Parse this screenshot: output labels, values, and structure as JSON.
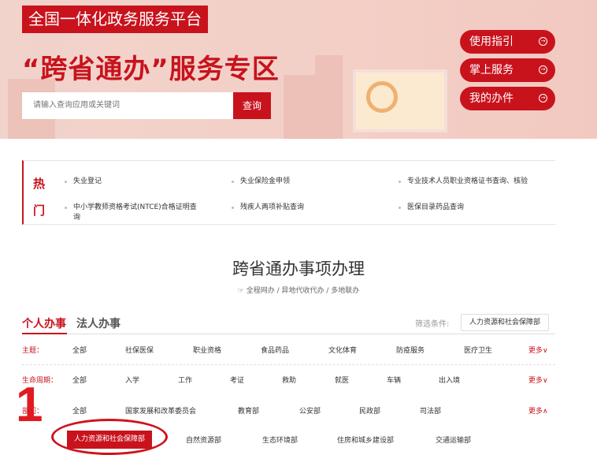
{
  "banner": {
    "platform": "全国一体化政务服务平台",
    "headline": "“跨省通办”服务专区",
    "search_placeholder": "请输入查询应用或关键词",
    "search_button": "查询",
    "side_buttons": [
      {
        "label": "使用指引"
      },
      {
        "label": "掌上服务"
      },
      {
        "label": "我的办件"
      }
    ]
  },
  "hot": {
    "title_1": "热",
    "title_2": "门",
    "items": [
      "失业登记",
      "失业保险金申领",
      "专业技术人员职业资格证书查询、核验",
      "中小学教师资格考试(NTCE)合格证明查询",
      "残疾人两项补贴查询",
      "医保目录药品查询"
    ]
  },
  "section": {
    "title": "跨省通办事项办理",
    "subtitle": "全程网办 / 异地代收代办 / 多地联办"
  },
  "tabs": [
    {
      "label": "个人办事"
    },
    {
      "label": "法人办事"
    }
  ],
  "filter": {
    "label": "筛选条件:",
    "value": "人力资源和社会保障部"
  },
  "rows": {
    "theme": {
      "label": "主题：",
      "items": [
        "全部",
        "社保医保",
        "职业资格",
        "食品药品",
        "文化体育",
        "防疫服务",
        "医疗卫生"
      ],
      "more": "更多∨"
    },
    "life": {
      "label": "生命周期：",
      "items": [
        "全部",
        "入学",
        "工作",
        "考证",
        "救助",
        "就医",
        "车辆",
        "出入境"
      ],
      "more": "更多∨"
    },
    "dept": {
      "label": "部门：",
      "items": [
        "全部",
        "国家发展和改革委员会",
        "教育部",
        "公安部",
        "民政部",
        "司法部"
      ],
      "items2": [
        "人力资源和社会保障部",
        "自然资源部",
        "生态环境部",
        "住房和城乡建设部",
        "交通运输部"
      ],
      "more": "更多∧"
    }
  },
  "annotation": "1",
  "colors": {
    "brand": "#c8131d"
  }
}
